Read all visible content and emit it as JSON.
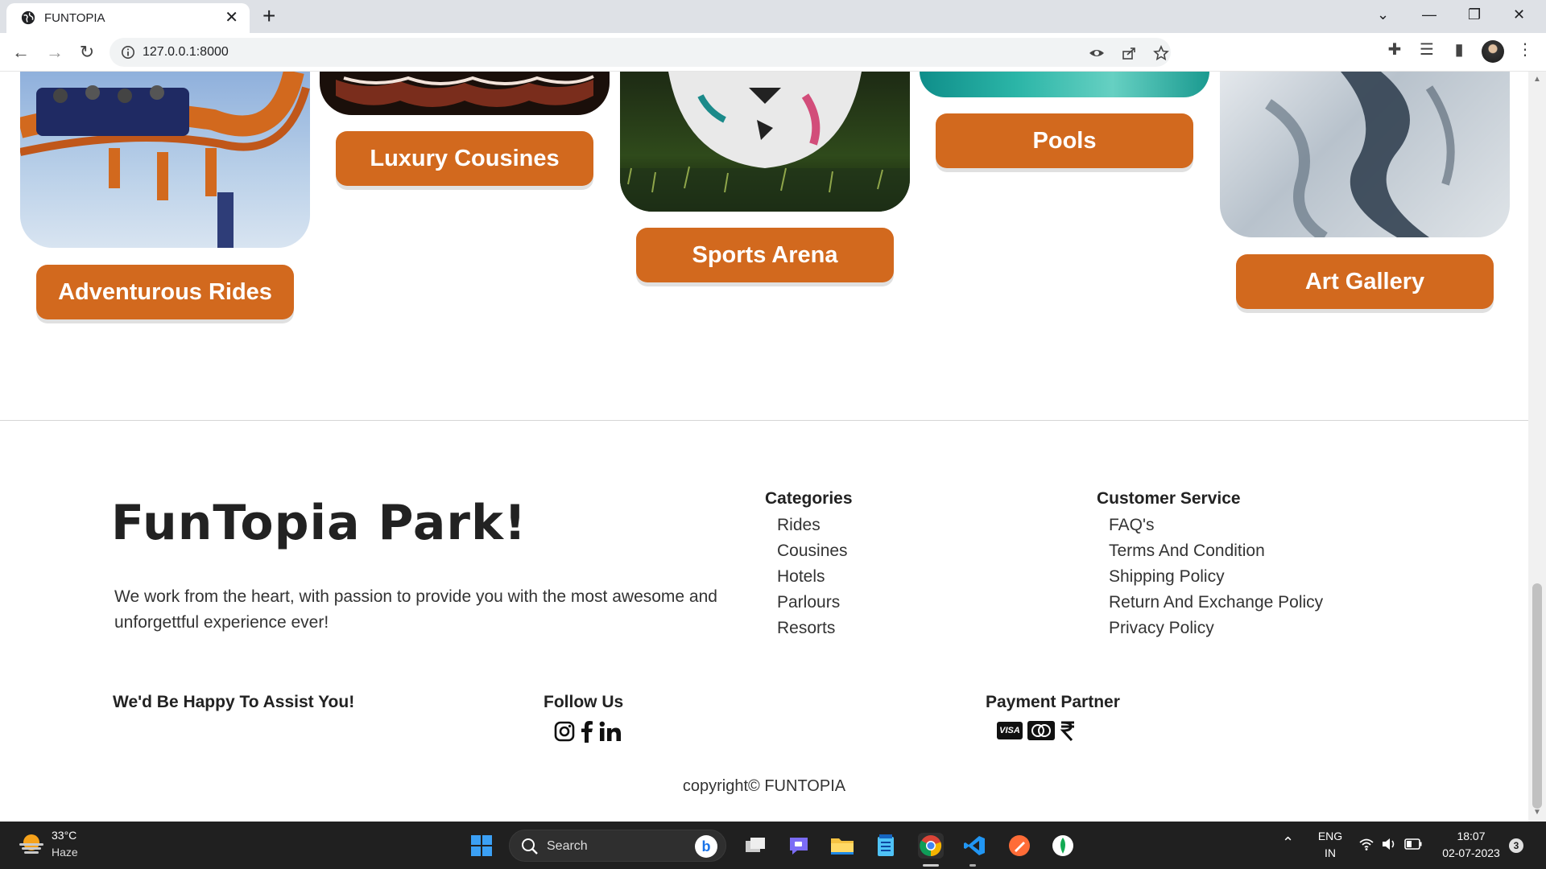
{
  "browser": {
    "tab_title": "FUNTOPIA",
    "url": "127.0.0.1:8000"
  },
  "cards": [
    {
      "label": "Adventurous Rides"
    },
    {
      "label": "Luxury Cousines"
    },
    {
      "label": "Sports Arena"
    },
    {
      "label": "Pools"
    },
    {
      "label": "Art Gallery"
    }
  ],
  "footer": {
    "brand": "FunTopia Park!",
    "tagline": "We work from the heart, with passion to provide you with the most awesome and unforgettful experience ever!",
    "categories": {
      "title": "Categories",
      "items": [
        "Rides",
        "Cousines",
        "Hotels",
        "Parlours",
        "Resorts"
      ]
    },
    "customer_service": {
      "title": "Customer Service",
      "items": [
        "FAQ's",
        "Terms And Condition",
        "Shipping Policy",
        "Return And Exchange Policy",
        "Privacy Policy"
      ]
    },
    "assist": "We'd Be Happy To Assist You!",
    "follow": "Follow Us",
    "payment": "Payment Partner",
    "visa": "VISA",
    "copyright": "copyright© FUNTOPIA"
  },
  "taskbar": {
    "temp": "33°C",
    "weather": "Haze",
    "search_label": "Search",
    "lang_1": "ENG",
    "lang_2": "IN",
    "time": "18:07",
    "date": "02-07-2023",
    "notifications": "3"
  },
  "colors": {
    "accent": "#d2691e",
    "taskbar": "#202020"
  }
}
